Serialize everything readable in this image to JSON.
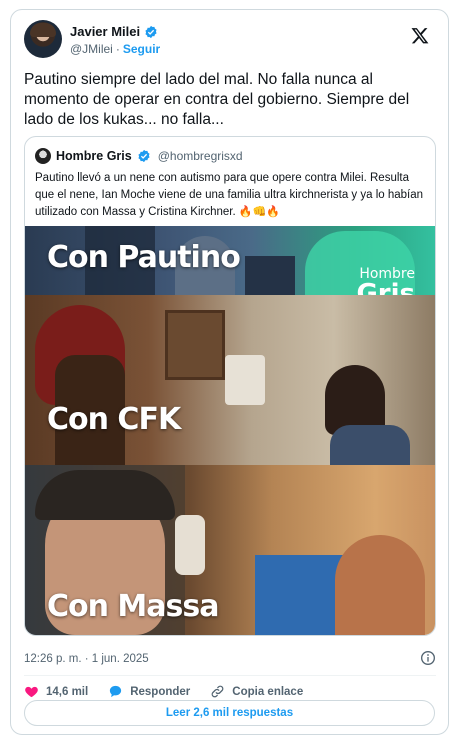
{
  "author": {
    "name": "Javier Milei",
    "handle": "@JMilei",
    "separator": "·",
    "follow_label": "Seguir"
  },
  "tweet": {
    "text": "Pautino siempre del lado del mal. No falla nunca al momento de operar en contra del gobierno. Siempre del lado de los kukas... no falla..."
  },
  "quoted": {
    "name": "Hombre Gris",
    "handle": "@hombregrisxd",
    "text": "Pautino llevó a un nene con autismo para  que opere contra Milei. Resulta que el nene, Ian Moche viene de una familia ultra kirchnerista y ya lo habían utilizado con Massa y Cristina Kirchner.",
    "emojis": "🔥👊🔥",
    "media": {
      "caption_1": "Con Pautino",
      "caption_2": "Con CFK",
      "caption_3": "Con Massa",
      "watermark_top": "Hombre",
      "watermark_bottom": "Gris"
    }
  },
  "meta": {
    "timestamp": "12:26 p. m. · 1 jun. 2025"
  },
  "actions": {
    "likes": "14,6 mil",
    "reply_label": "Responder",
    "copy_label": "Copia enlace"
  },
  "read_more_label": "Leer 2,6 mil respuestas",
  "colors": {
    "accent": "#1d9bf0",
    "like": "#f91880",
    "text": "#0f1419",
    "muted": "#536471",
    "border": "#cfd9de"
  },
  "icons": [
    "verified-badge-icon",
    "x-logo-icon",
    "info-icon",
    "heart-icon",
    "reply-bubble-icon",
    "link-icon"
  ]
}
